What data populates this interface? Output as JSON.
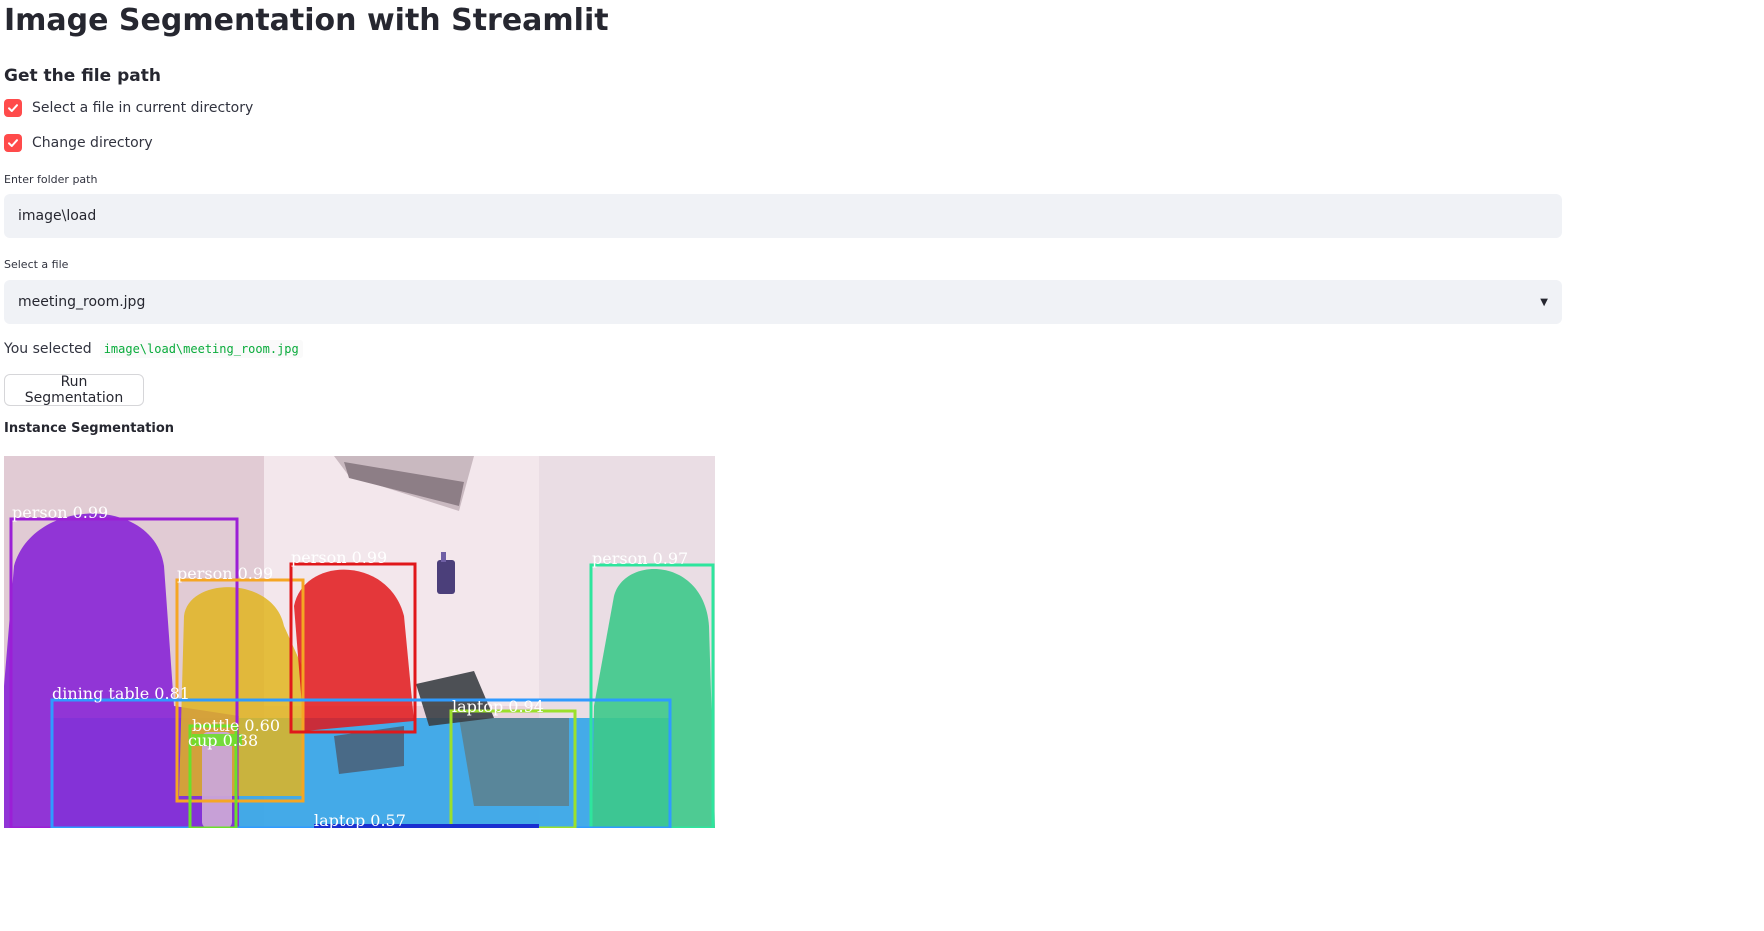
{
  "app": {
    "title": "Image Segmentation with Streamlit",
    "subheader": "Get the file path"
  },
  "checkboxes": [
    {
      "label": "Select a file in current directory",
      "checked": true
    },
    {
      "label": "Change directory",
      "checked": true
    }
  ],
  "folder_input": {
    "label": "Enter folder path",
    "value": "image\\load"
  },
  "file_select": {
    "label": "Select a file",
    "value": "meeting_room.jpg"
  },
  "selection": {
    "prefix": "You selected",
    "path": "image\\load\\meeting_room.jpg"
  },
  "run_button": {
    "label": "Run Segmentation"
  },
  "result": {
    "title": "Instance Segmentation",
    "detections": [
      {
        "label": "person 0.99",
        "color": "#9b1fd6"
      },
      {
        "label": "person 0.99",
        "color": "#f5a623"
      },
      {
        "label": "person 0.99",
        "color": "#e0181b"
      },
      {
        "label": "person 0.97",
        "color": "#2ee59d"
      },
      {
        "label": "dining table 0.81",
        "color": "#2f9bff"
      },
      {
        "label": "bottle 0.60",
        "color": "#6be02b"
      },
      {
        "label": "cup 0.38",
        "color": "#c9a0ff"
      },
      {
        "label": "laptop 0.94",
        "color": "#9be02b"
      },
      {
        "label": "laptop 0.57",
        "color": "#1a2fd0"
      }
    ]
  },
  "colors": {
    "accent": "#ff4b4b",
    "input_bg": "#f0f2f6",
    "code_text": "#09ab3b"
  }
}
